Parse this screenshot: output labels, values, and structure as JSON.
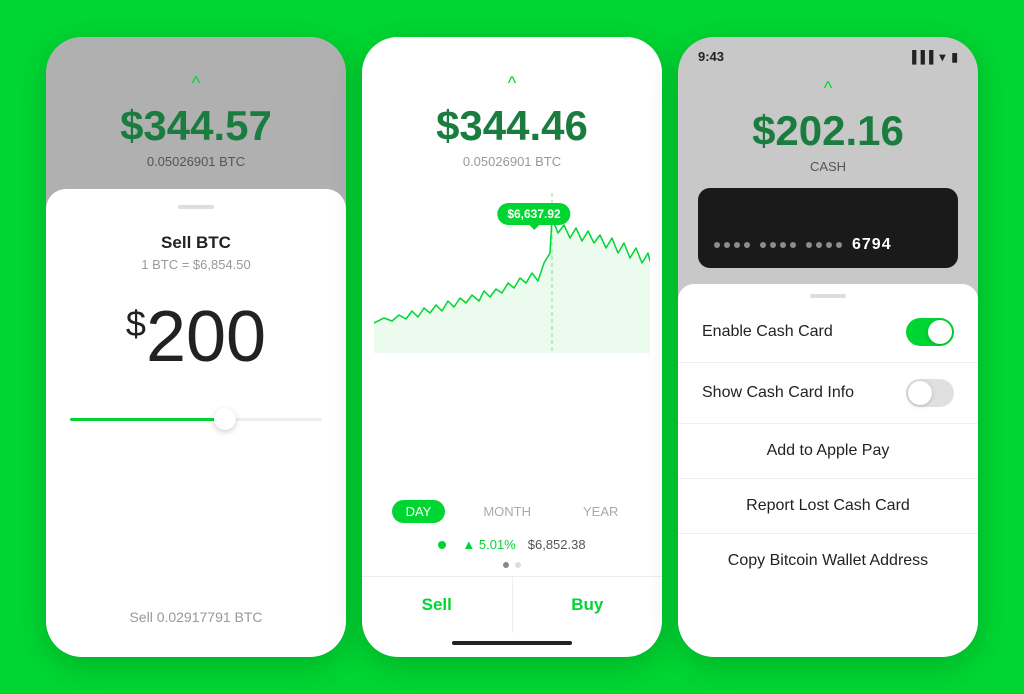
{
  "phone1": {
    "chevron": "^",
    "balance": "$344.57",
    "btc_amount": "0.05026901 BTC",
    "sell_title": "Sell BTC",
    "rate": "1 BTC = $6,854.50",
    "dollar_amount": "200",
    "dollar_sign": "$",
    "sell_label": "Sell 0.02917791 BTC"
  },
  "phone2": {
    "chevron": "^",
    "balance": "$344.46",
    "btc_amount": "0.05026901 BTC",
    "tooltip_price": "$6,637.92",
    "time_tabs": [
      "DAY",
      "MONTH",
      "YEAR"
    ],
    "active_tab": "DAY",
    "pct_change": "▲ 5.01%",
    "price": "$6,852.38",
    "sell_button": "Sell",
    "buy_button": "Buy"
  },
  "phone3": {
    "status_time": "9:43",
    "balance": "$202.16",
    "cash_label": "CASH",
    "card_last4": "6794",
    "chevron": "^",
    "enable_card_label": "Enable Cash Card",
    "show_card_info_label": "Show Cash Card Info",
    "apple_pay_label": "Add to Apple Pay",
    "report_lost_label": "Report Lost Cash Card",
    "copy_bitcoin_label": "Copy Bitcoin Wallet Address",
    "enable_toggle": "on",
    "show_info_toggle": "off"
  }
}
